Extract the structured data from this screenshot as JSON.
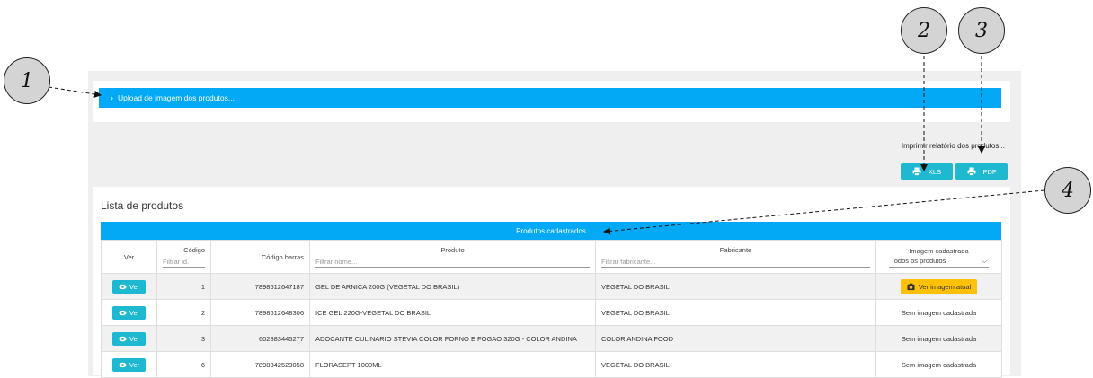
{
  "upload": {
    "label": "Upload de imagem dos produtos..."
  },
  "report": {
    "title": "Imprimir relatório dos produtos...",
    "xls_label": "XLS",
    "pdf_label": "PDF"
  },
  "list": {
    "title": "Lista de produtos",
    "table_title": "Produtos cadastrados",
    "columns": {
      "ver": "Ver",
      "codigo": "Código",
      "codigo_filter": "Filtrar id.",
      "barras": "Código barras",
      "produto": "Produto",
      "produto_filter": "Filtrar nome...",
      "fabricante": "Fabricante",
      "fabricante_filter": "Filtrar fabricante...",
      "imagem": "Imagem cadastrada",
      "imagem_select": "Todos os produtos"
    },
    "rows": [
      {
        "ver": "Ver",
        "id": "1",
        "barcode": "7898612647187",
        "produto": "GEL DE ARNICA 200G (VEGETAL DO BRASIL)",
        "fabricante": "VEGETAL DO BRASIL",
        "imagem": "Ver imagem atual"
      },
      {
        "ver": "Ver",
        "id": "2",
        "barcode": "7898612648306",
        "produto": "ICE GEL 220G-VEGETAL DO BRASIL",
        "fabricante": "VEGETAL DO BRASIL",
        "imagem": "Sem imagem cadastrada"
      },
      {
        "ver": "Ver",
        "id": "3",
        "barcode": "602883445277",
        "produto": "ADOCANTE CULINARIO STEVIA COLOR FORNO E FOGAO 320G - COLOR ANDINA",
        "fabricante": "COLOR ANDINA FOOD",
        "imagem": "Sem imagem cadastrada"
      },
      {
        "ver": "Ver",
        "id": "6",
        "barcode": "7898342523058",
        "produto": "FLORASEPT 1000ML",
        "fabricante": "VEGETAL DO BRASIL",
        "imagem": "Sem imagem cadastrada"
      }
    ]
  },
  "callouts": {
    "c1": "1",
    "c2": "2",
    "c3": "3",
    "c4": "4"
  },
  "colors": {
    "primary": "#03a9f4",
    "button": "#1eb8d0",
    "warning": "#ffc107"
  }
}
